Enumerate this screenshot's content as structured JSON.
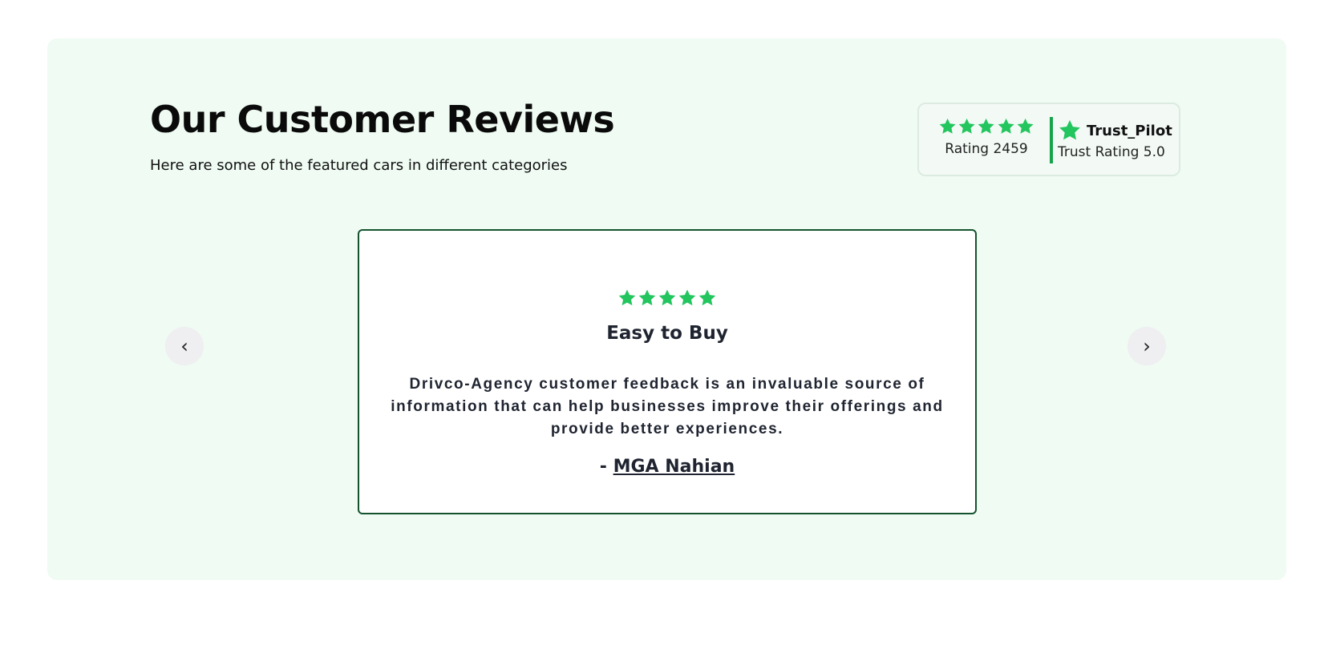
{
  "header": {
    "title": "Our Customer Reviews",
    "subtitle": "Here are some of the featured cars in different categories"
  },
  "rating_summary": {
    "stars": 5,
    "rating_label": "Rating 2459",
    "provider_name": "Trust_Pilot",
    "provider_rating": "Trust Rating 5.0",
    "star_color": "#22c55e",
    "provider_icon": "star-icon"
  },
  "carousel": {
    "prev_label": "‹",
    "next_label": "›",
    "review": {
      "stars": 5,
      "title": "Easy to Buy",
      "text": "Drivco-Agency customer feedback is an invaluable source of information that can help businesses improve their offerings and provide better experiences.",
      "author_prefix": "- ",
      "author_name": "MGA Nahian"
    }
  },
  "colors": {
    "section_bg": "#effbf3",
    "accent_green": "#22c55e",
    "divider_green": "#16a34a",
    "card_border": "#14532d"
  }
}
